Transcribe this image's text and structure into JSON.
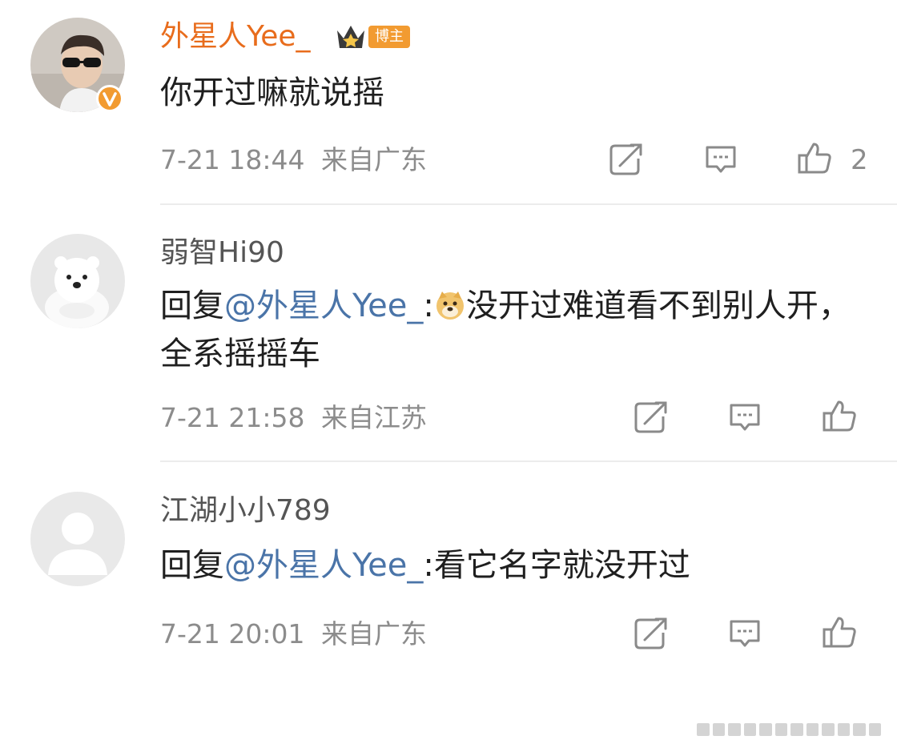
{
  "comments": [
    {
      "username": "外星人Yee_",
      "badge": "博主",
      "text": "你开过嘛就说摇",
      "time": "7-21 18:44",
      "location": "来自广东",
      "likes": "2"
    },
    {
      "username": "弱智Hi90",
      "reply_prefix": "回复",
      "mention": "@外星人Yee_",
      "colon": ":",
      "text": "没开过难道看不到别人开，全系摇摇车",
      "time": "7-21 21:58",
      "location": "来自江苏"
    },
    {
      "username": "江湖小小789",
      "reply_prefix": "回复",
      "mention": "@外星人Yee_",
      "colon": ":",
      "text": "看它名字就没开过",
      "time": "7-21 20:01",
      "location": "来自广东"
    }
  ],
  "icons": {
    "repost": "repost-icon",
    "comment": "comment-icon",
    "like": "like-icon",
    "verified": "verified-icon",
    "crown": "crown-icon",
    "doge": "doge-emoji-icon"
  },
  "colors": {
    "blogger_name": "#e86c1c",
    "badge": "#f29b31",
    "mention": "#4a74a8",
    "meta": "#8c8c8c"
  }
}
